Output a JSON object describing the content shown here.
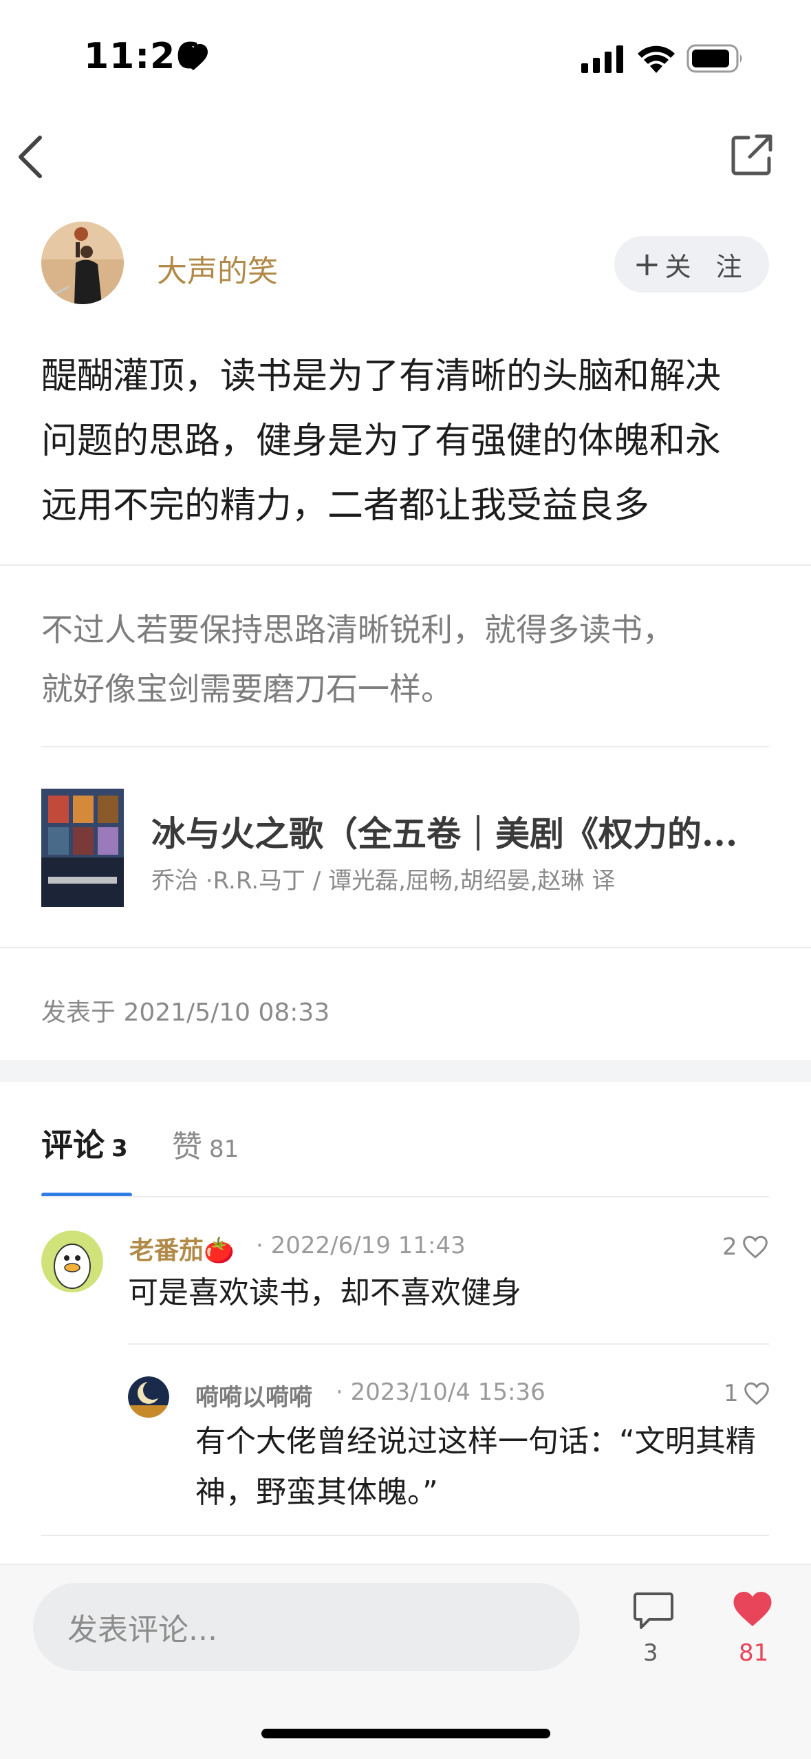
{
  "status_bar": {
    "time": "11:26"
  },
  "author": {
    "name": "大声的笑",
    "follow_label": "关 注"
  },
  "post": {
    "lines": [
      "醍醐灌顶，读书是为了有清晰的头脑和解决",
      "问题的思路，健身是为了有强健的体魄和永",
      "远用不完的精力，二者都让我受益良多"
    ],
    "quote_lines": [
      "不过人若要保持思路清晰锐利，就得多读书，",
      "就好像宝剑需要磨刀石一样。"
    ],
    "book": {
      "title": "冰与火之歌（全五卷｜美剧《权力的...",
      "authors": "乔治 ·R.R.马丁 / 谭光磊,屈畅,胡绍晏,赵琳 译"
    },
    "published": "发表于 2021/5/10 08:33"
  },
  "tabs": {
    "comments_label": "评论",
    "comments_count": "3",
    "likes_label": "赞",
    "likes_count": "81"
  },
  "comments": [
    {
      "name": "老番茄🍅",
      "time": "· 2022/6/19 11:43",
      "text": "可是喜欢读书，却不喜欢健身",
      "likes": "2"
    },
    {
      "name": "嗬嗬以嗬嗬",
      "time": "· 2023/10/4 15:36",
      "text_lines": [
        "有个大佬曾经说过这样一句话：“文明其精",
        "神，野蛮其体魄。”"
      ],
      "likes": "1"
    }
  ],
  "bottom_bar": {
    "input_placeholder": "发表评论...",
    "comment_count": "3",
    "like_count": "81"
  },
  "colors": {
    "accent_gold": "#b18a47",
    "tab_blue": "#2f7ee8",
    "like_red": "#e8445a"
  }
}
